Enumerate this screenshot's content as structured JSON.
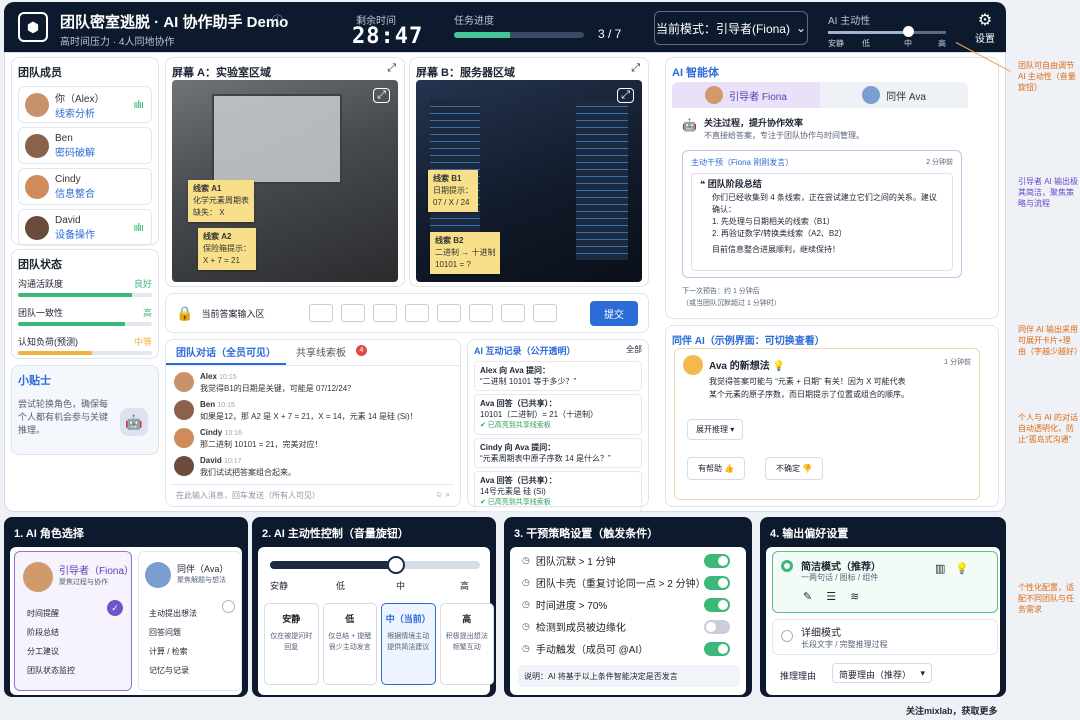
{
  "header": {
    "title": "团队密室逃脱 · AI 协作助手 Demo",
    "subtitle": "高时间压力 · 4人同地协作",
    "time_label": "剩余时间",
    "time_value": "28:47",
    "progress_label": "任务进度",
    "progress_text": "3 / 7",
    "progress_fraction": 0.43,
    "mode_label": "当前模式：引导者(Fiona)",
    "ai_level_label": "AI 主动性",
    "ai_level_ticks": [
      "安静",
      "低",
      "中",
      "高"
    ],
    "ai_level_value": 0.68,
    "settings_label": "设置"
  },
  "members": {
    "title": "团队成员",
    "items": [
      {
        "name": "你（Alex）",
        "role": "线索分析"
      },
      {
        "name": "Ben",
        "role": "密码破解"
      },
      {
        "name": "Cindy",
        "role": "信息整合"
      },
      {
        "name": "David",
        "role": "设备操作"
      }
    ]
  },
  "status": {
    "title": "团队状态",
    "items": [
      {
        "label": "沟通活跃度",
        "value": "良好",
        "level": 0.85,
        "color": "#3cb878"
      },
      {
        "label": "团队一致性",
        "value": "高",
        "level": 0.8,
        "color": "#3cb878"
      },
      {
        "label": "认知负荷(预测)",
        "value": "中等",
        "level": 0.55,
        "color": "#f0b43c"
      }
    ]
  },
  "tips": {
    "title": "小贴士",
    "text": "尝试轮换角色，确保每个人都有机会参与关键推理。"
  },
  "screenA": {
    "title": "屏幕 A：实验室区域",
    "notes": [
      {
        "t": "线索 A1",
        "b": "化学元素周期表\n缺失： X"
      },
      {
        "t": "线索 A2",
        "b": "保险箱提示：\nX + 7 = 21"
      }
    ]
  },
  "screenB": {
    "title": "屏幕 B：服务器区域",
    "notes": [
      {
        "t": "线索 B1",
        "b": "日期提示：\n07 / X / 24"
      },
      {
        "t": "线索 B2",
        "b": "二进制 → 十进制\n10101 = ?"
      }
    ]
  },
  "answer": {
    "label": "当前答案输入区",
    "submit": "提交"
  },
  "chat": {
    "tab1": "团队对话（全员可见）",
    "tab2": "共享线索板",
    "badge": "4",
    "placeholder": "在此输入消息，回车发送（所有人可见）",
    "messages": [
      {
        "name": "Alex",
        "time": "10:15",
        "text": "我觉得B1的日期是关键，可能是 07/12/24？"
      },
      {
        "name": "Ben",
        "time": "10:15",
        "text": "如果是12，那 A2 是 X + 7 = 21，X = 14，元素 14 是硅 (Si)！"
      },
      {
        "name": "Cindy",
        "time": "10:16",
        "text": "那二进制 10101 = 21，完美对应！"
      },
      {
        "name": "David",
        "time": "10:17",
        "text": "我们试试把答案组合起来。"
      }
    ]
  },
  "ailog": {
    "title": "AI 互动记录（公开透明）",
    "filter": "全部",
    "items": [
      {
        "a": "Alex 向 Ava 提问：",
        "b": "“二进制 10101 等于多少？”",
        "c": ""
      },
      {
        "a": "Ava 回答（已共享）：",
        "b": "10101（二进制）= 21（十进制）",
        "c": "已高亮到共享线索板"
      },
      {
        "a": "Cindy 向 Ava 提问：",
        "b": "“元素周期表中原子序数 14 是什么？”",
        "c": ""
      },
      {
        "a": "Ava 回答（已共享）：",
        "b": "14号元素是 硅 (Si)",
        "c": "已高亮到共享线索板"
      }
    ]
  },
  "agents": {
    "title": "AI 智能体",
    "tab1": "引导者 Fiona",
    "tab2": "同伴 Ava",
    "focus_title": "关注过程，提升协作效率",
    "focus_sub": "不直接给答案，专注于团队协作与时间管理。",
    "intervention": "主动干预（Fiona 刚刚发言）",
    "intervention_time": "2 分钟前",
    "summary_title": "团队阶段总结",
    "summary_text": "你们已经收集到 4 条线索，正在尝试建立它们之间的关系。建议确认：",
    "summary_items": [
      "1. 先处理与日期相关的线索（B1）",
      "2. 再验证数学/转换类线索（A2、B2）"
    ],
    "summary_end": "目前信息整合进展顺利，继续保持！",
    "next": "下一次预告：约 1 分钟后",
    "next2": "（或当团队沉默超过 1 分钟时）"
  },
  "peer": {
    "title": "同伴 AI（示例界面：可切换查看）",
    "name": "Ava 的新想法 💡",
    "time": "1 分钟前",
    "text": "我觉得答案可能与 “元素 + 日期” 有关！因为 X 可能代表某个元素的原子序数，而日期提示了位置或组合的顺序。",
    "expand": "展开推理",
    "helpful": "有帮助",
    "unsure": "不确定"
  },
  "b1": {
    "title": "1. AI 角色选择",
    "r1": "引导者（Fiona）",
    "r1s": "聚焦过程与协作",
    "r1items": [
      "时间提醒",
      "阶段总结",
      "分工建议",
      "团队状态监控"
    ],
    "r2": "同伴（Ava）",
    "r2s": "聚焦解题与想法",
    "r2items": [
      "主动提出想法",
      "回答问题",
      "计算 / 检索",
      "记忆与记录"
    ]
  },
  "b2": {
    "title": "2. AI 主动性控制（音量旋钮）",
    "ticks": [
      "安静",
      "低",
      "中",
      "高"
    ],
    "value": 0.6,
    "opts": [
      {
        "t": "安静",
        "d": "仅在被提问时回复"
      },
      {
        "t": "低",
        "d": "仅总结 + 提醒很少主动发言"
      },
      {
        "t": "中（当前）",
        "d": "根据情境主动提供简洁建议"
      },
      {
        "t": "高",
        "d": "积极提出想法频繁互动"
      }
    ]
  },
  "b3": {
    "title": "3. 干预策略设置（触发条件）",
    "items": [
      {
        "t": "团队沉默 > 1 分钟",
        "on": true
      },
      {
        "t": "团队卡壳（重复讨论同一点 > 2 分钟）",
        "on": true
      },
      {
        "t": "时间进度 > 70%",
        "on": true
      },
      {
        "t": "检测到成员被边缘化",
        "on": false
      },
      {
        "t": "手动触发（成员可 @AI）",
        "on": true
      }
    ],
    "note": "说明：AI 将基于以上条件智能决定是否发言"
  },
  "b4": {
    "title": "4. 输出偏好设置",
    "o1": "简洁模式（推荐）",
    "o1s": "一两句话 / 图标 / 组件",
    "o2": "详细模式",
    "o2s": "长段文字 / 完整推理过程",
    "reason_label": "推理理由",
    "reason_value": "简要理由（推荐）"
  },
  "annotations": [
    "团队可自由调节 AI 主动性（音量旋钮）",
    "引导者 AI 输出极其简洁，聚焦策略与流程",
    "同伴 AI 输出采用可展开卡片+理由（字越少越好）",
    "个人与 AI 的对话自动透明化，防止“孤岛式沟通”",
    "个性化配置，适配不同团队与任务需求"
  ],
  "footer": "关注mixlab，获取更多"
}
